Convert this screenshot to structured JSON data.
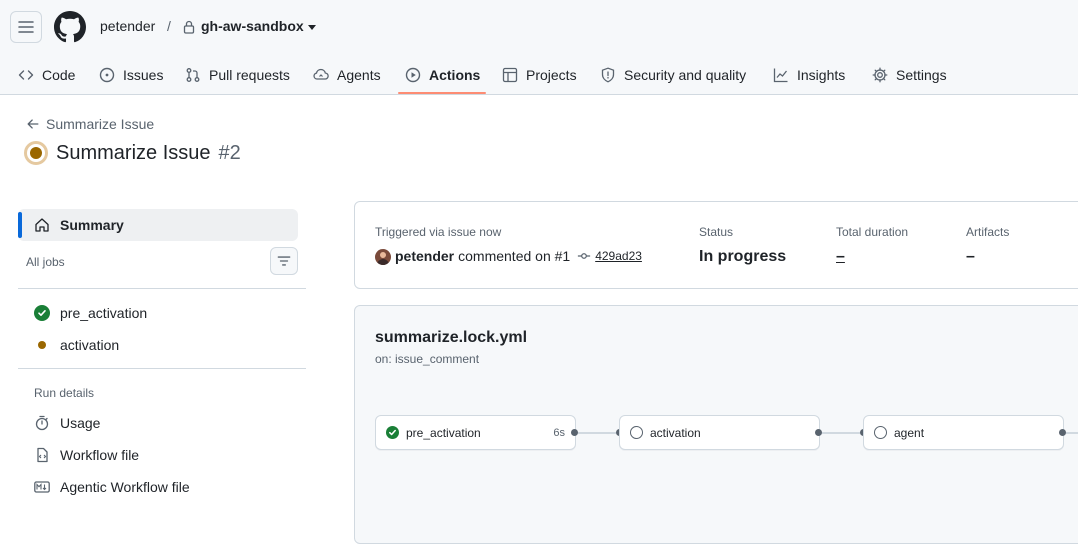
{
  "header": {
    "owner": "petender",
    "separator": "/",
    "repo": "gh-aw-sandbox"
  },
  "tabs": [
    {
      "label": "Code",
      "icon": "code-icon"
    },
    {
      "label": "Issues",
      "icon": "issue-icon"
    },
    {
      "label": "Pull requests",
      "icon": "pull-request-icon"
    },
    {
      "label": "Agents",
      "icon": "agents-icon"
    },
    {
      "label": "Actions",
      "icon": "play-icon",
      "active": true
    },
    {
      "label": "Projects",
      "icon": "table-icon"
    },
    {
      "label": "Security and quality",
      "icon": "shield-icon"
    },
    {
      "label": "Insights",
      "icon": "graph-icon"
    },
    {
      "label": "Settings",
      "icon": "gear-icon"
    }
  ],
  "run": {
    "back_label": "Summarize Issue",
    "title": "Summarize Issue",
    "number": "#2"
  },
  "sidebar": {
    "summary_label": "Summary",
    "all_jobs_label": "All jobs",
    "jobs": [
      {
        "label": "pre_activation",
        "status": "success"
      },
      {
        "label": "activation",
        "status": "in-progress"
      }
    ],
    "run_details_label": "Run details",
    "details": [
      {
        "label": "Usage",
        "icon": "stopwatch-icon"
      },
      {
        "label": "Workflow file",
        "icon": "file-code-icon"
      },
      {
        "label": "Agentic Workflow file",
        "icon": "markdown-icon"
      }
    ]
  },
  "summary": {
    "triggered_label": "Triggered via issue now",
    "actor": "petender",
    "action_text": "commented on #1",
    "commit": "429ad23",
    "status_label": "Status",
    "status_value": "In progress",
    "duration_label": "Total duration",
    "duration_value": "–",
    "artifacts_label": "Artifacts",
    "artifacts_value": "–"
  },
  "workflow": {
    "file": "summarize.lock.yml",
    "trigger": "on: issue_comment",
    "jobs": [
      {
        "name": "pre_activation",
        "status": "success",
        "duration": "6s"
      },
      {
        "name": "activation",
        "status": "queued",
        "duration": ""
      },
      {
        "name": "agent",
        "status": "queued",
        "duration": ""
      }
    ]
  },
  "colors": {
    "accent": "#0969da",
    "success": "#1a7f37",
    "in_progress": "#9a6700",
    "tab_underline": "#fd8c73"
  }
}
